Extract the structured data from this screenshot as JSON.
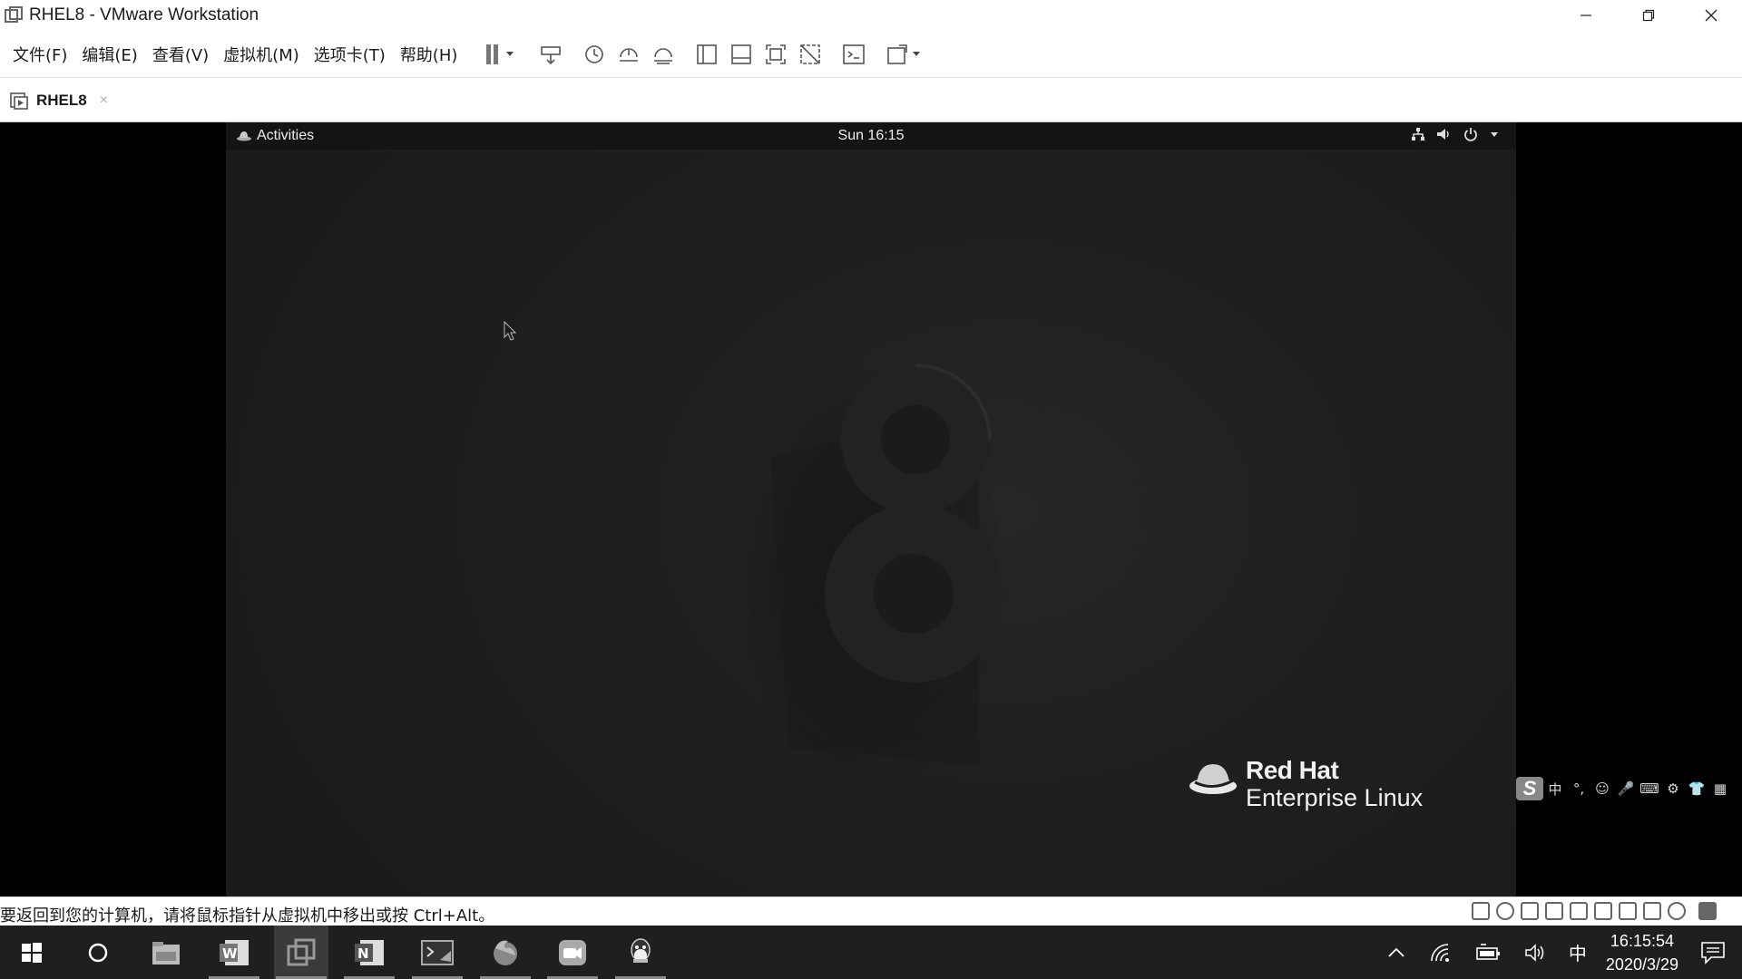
{
  "window": {
    "title": "RHEL8 - VMware Workstation",
    "controls": [
      "minimize",
      "restore",
      "close"
    ]
  },
  "menu": {
    "items": [
      "文件(F)",
      "编辑(E)",
      "查看(V)",
      "虚拟机(M)",
      "选项卡(T)",
      "帮助(H)"
    ]
  },
  "toolbar": {
    "icons": [
      "pause-icon",
      "send-ctrl-alt-del-icon",
      "snapshot-icon",
      "revert-snapshot-icon",
      "snapshot-manager-icon",
      "library-view-icon",
      "thumbnail-view-icon",
      "fullscreen-icon",
      "unity-icon",
      "console-icon",
      "stretch-view-icon"
    ]
  },
  "tab": {
    "label": "RHEL8",
    "close": "×"
  },
  "guest": {
    "activities_label": "Activities",
    "clock": "Sun 16:15",
    "brand_name": "Red Hat",
    "brand_product": "Enterprise Linux",
    "version_glyph": "8"
  },
  "ime": {
    "logo": "S",
    "items": [
      "中",
      "°,",
      "☺",
      "🎤",
      "⌨",
      "⚙",
      "👕",
      "▦"
    ]
  },
  "status": {
    "message": "要返回到您的计算机，请将鼠标指针从虚拟机中移出或按 Ctrl+Alt。"
  },
  "taskbar": {
    "tray_ime": "中",
    "time": "16:15:54",
    "date": "2020/3/29"
  },
  "colors": {
    "guest_bg": "#1f1f1f",
    "guest_topbar": "#141414",
    "taskbar": "#1f1f1f"
  }
}
